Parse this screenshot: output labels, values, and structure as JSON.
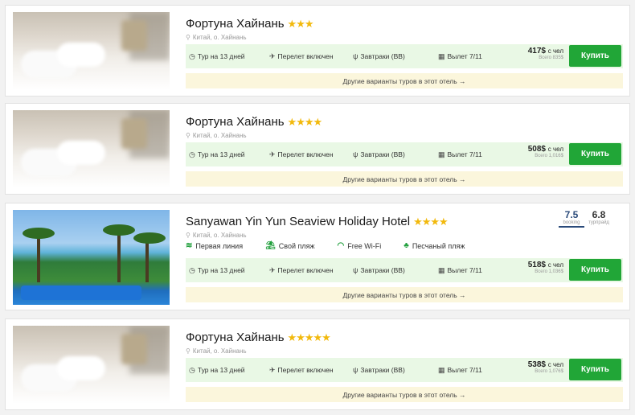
{
  "colors": {
    "accent_green": "#21a637",
    "star": "#f2b90d",
    "bar_bg": "#e9f8e5",
    "other_bg": "#fbf6dc",
    "booking_blue": "#2a4a7a"
  },
  "common": {
    "tour": "Тур на 13 дней",
    "flight": "Перелет включен",
    "meal": "Завтраки (BB)",
    "departure": "Вылет 7/11",
    "per_person": "с чел",
    "buy_label": "Купить",
    "other_variants": "Другие варианты туров в этот отель →",
    "location": "Китай, о. Хайнань"
  },
  "hotels": [
    {
      "name": "Фортуна Хайнань",
      "stars": "★★★",
      "star_count": 3,
      "price": "417$",
      "total": "Всего 835$",
      "image": "hotel-room-photo"
    },
    {
      "name": "Фортуна Хайнань",
      "stars": "★★★★",
      "star_count": 4,
      "price": "508$",
      "total": "Всего 1,016$",
      "image": "hotel-room-photo"
    },
    {
      "name": "Sanyawan Yin Yun Seaview Holiday Hotel",
      "stars": "★★★★",
      "star_count": 4,
      "price": "518$",
      "total": "Всего 1,036$",
      "image": "beach-resort-photo",
      "features": [
        "Первая линия",
        "Свой пляж",
        "Free Wi-Fi",
        "Песчаный пляж"
      ],
      "rating_booking": "7.5",
      "rating_booking_label": "booking",
      "rating_trip": "6.8",
      "rating_trip_label": "турпрайд"
    },
    {
      "name": "Фортуна Хайнань",
      "stars": "★★★★★",
      "star_count": 5,
      "price": "538$",
      "total": "Всего 1,076$",
      "image": "hotel-room-photo"
    }
  ]
}
